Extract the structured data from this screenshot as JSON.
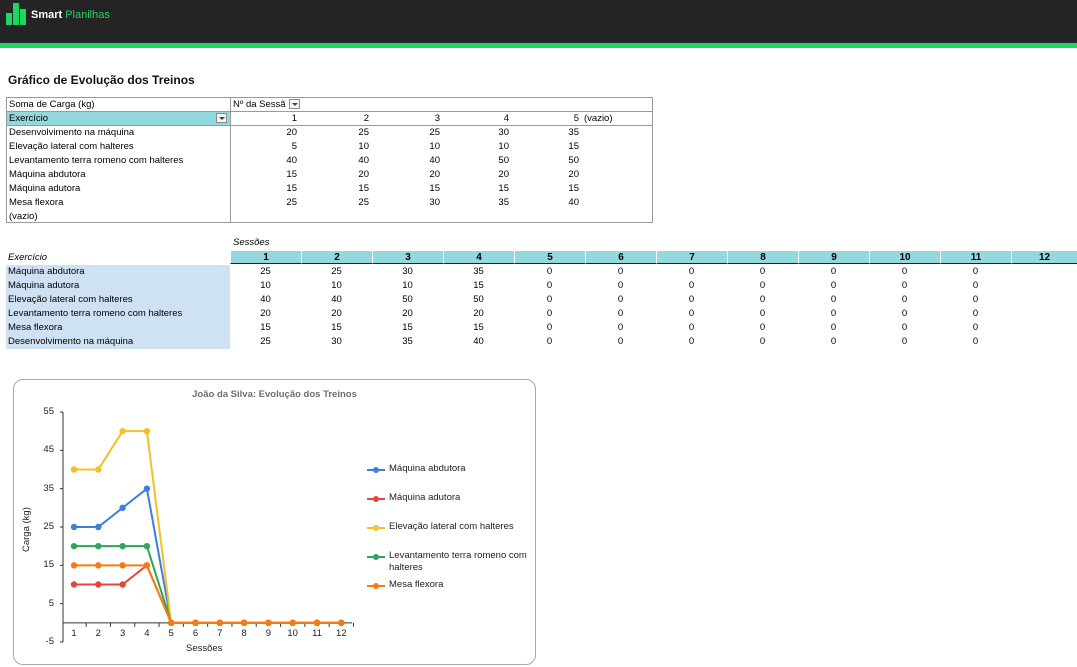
{
  "header": {
    "brand": "Smart",
    "brand_sub": "Planilhas",
    "accent_color": "#1ed760",
    "bar_color": "#242424"
  },
  "page_title": "Gráfico de Evolução dos Treinos",
  "pivot": {
    "value_label": "Soma de Carga (kg)",
    "column_field": "Nº da Sessã",
    "row_field": "Exercício",
    "column_headers": [
      "1",
      "2",
      "3",
      "4",
      "5",
      "(vazio)"
    ],
    "rows": [
      {
        "label": "Desenvolvimento na máquina",
        "values": [
          "20",
          "25",
          "25",
          "30",
          "35"
        ]
      },
      {
        "label": "Elevação lateral com halteres",
        "values": [
          "5",
          "10",
          "10",
          "10",
          "15"
        ]
      },
      {
        "label": "Levantamento terra romeno com halteres",
        "values": [
          "40",
          "40",
          "40",
          "50",
          "50"
        ]
      },
      {
        "label": "Máquina abdutora",
        "values": [
          "15",
          "20",
          "20",
          "20",
          "20"
        ]
      },
      {
        "label": "Máquina adutora",
        "values": [
          "15",
          "15",
          "15",
          "15",
          "15"
        ]
      },
      {
        "label": "Mesa flexora",
        "values": [
          "25",
          "25",
          "30",
          "35",
          "40"
        ]
      },
      {
        "label": "(vazio)",
        "values": [
          "",
          "",
          "",
          "",
          ""
        ]
      }
    ]
  },
  "sessions_table": {
    "caption_sessions": "Sessões",
    "caption_exercise": "Exercício",
    "headers": [
      "1",
      "2",
      "3",
      "4",
      "5",
      "6",
      "7",
      "8",
      "9",
      "10",
      "11",
      "12"
    ],
    "rows": [
      {
        "label": "Máquina abdutora",
        "values": [
          "25",
          "25",
          "30",
          "35",
          "0",
          "0",
          "0",
          "0",
          "0",
          "0",
          "0"
        ]
      },
      {
        "label": "Máquina adutora",
        "values": [
          "10",
          "10",
          "10",
          "15",
          "0",
          "0",
          "0",
          "0",
          "0",
          "0",
          "0"
        ]
      },
      {
        "label": "Elevação lateral com halteres",
        "values": [
          "40",
          "40",
          "50",
          "50",
          "0",
          "0",
          "0",
          "0",
          "0",
          "0",
          "0"
        ]
      },
      {
        "label": "Levantamento terra romeno com halteres",
        "values": [
          "20",
          "20",
          "20",
          "20",
          "0",
          "0",
          "0",
          "0",
          "0",
          "0",
          "0"
        ]
      },
      {
        "label": "Mesa flexora",
        "values": [
          "15",
          "15",
          "15",
          "15",
          "0",
          "0",
          "0",
          "0",
          "0",
          "0",
          "0"
        ]
      },
      {
        "label": "Desenvolvimento na máquina",
        "values": [
          "25",
          "30",
          "35",
          "40",
          "0",
          "0",
          "0",
          "0",
          "0",
          "0",
          "0"
        ]
      }
    ]
  },
  "chart_data": {
    "type": "line",
    "title": "João da Silva: Evolução dos Treinos",
    "xlabel": "Sessões",
    "ylabel": "Carga (kg)",
    "x": [
      1,
      2,
      3,
      4,
      5,
      6,
      7,
      8,
      9,
      10,
      11,
      12
    ],
    "ylim": [
      -5,
      55
    ],
    "yticks": [
      -5,
      5,
      15,
      25,
      35,
      45,
      55
    ],
    "legend_position": "right",
    "grid": false,
    "series": [
      {
        "name": "Máquina abdutora",
        "color": "#3d7ddf",
        "values": [
          25,
          25,
          30,
          35,
          0,
          0,
          0,
          0,
          0,
          0,
          0,
          0
        ]
      },
      {
        "name": "Máquina adutora",
        "color": "#e6453a",
        "values": [
          10,
          10,
          10,
          15,
          0,
          0,
          0,
          0,
          0,
          0,
          0,
          0
        ]
      },
      {
        "name": "Elevação lateral com halteres",
        "color": "#f5c026",
        "values": [
          40,
          40,
          50,
          50,
          0,
          0,
          0,
          0,
          0,
          0,
          0,
          0
        ]
      },
      {
        "name": "Levantamento terra romeno com halteres",
        "color": "#2fa55a",
        "values": [
          20,
          20,
          20,
          20,
          0,
          0,
          0,
          0,
          0,
          0,
          0,
          0
        ]
      },
      {
        "name": "Mesa flexora",
        "color": "#fa7a10",
        "values": [
          15,
          15,
          15,
          15,
          0,
          0,
          0,
          0,
          0,
          0,
          0,
          0
        ]
      }
    ]
  }
}
